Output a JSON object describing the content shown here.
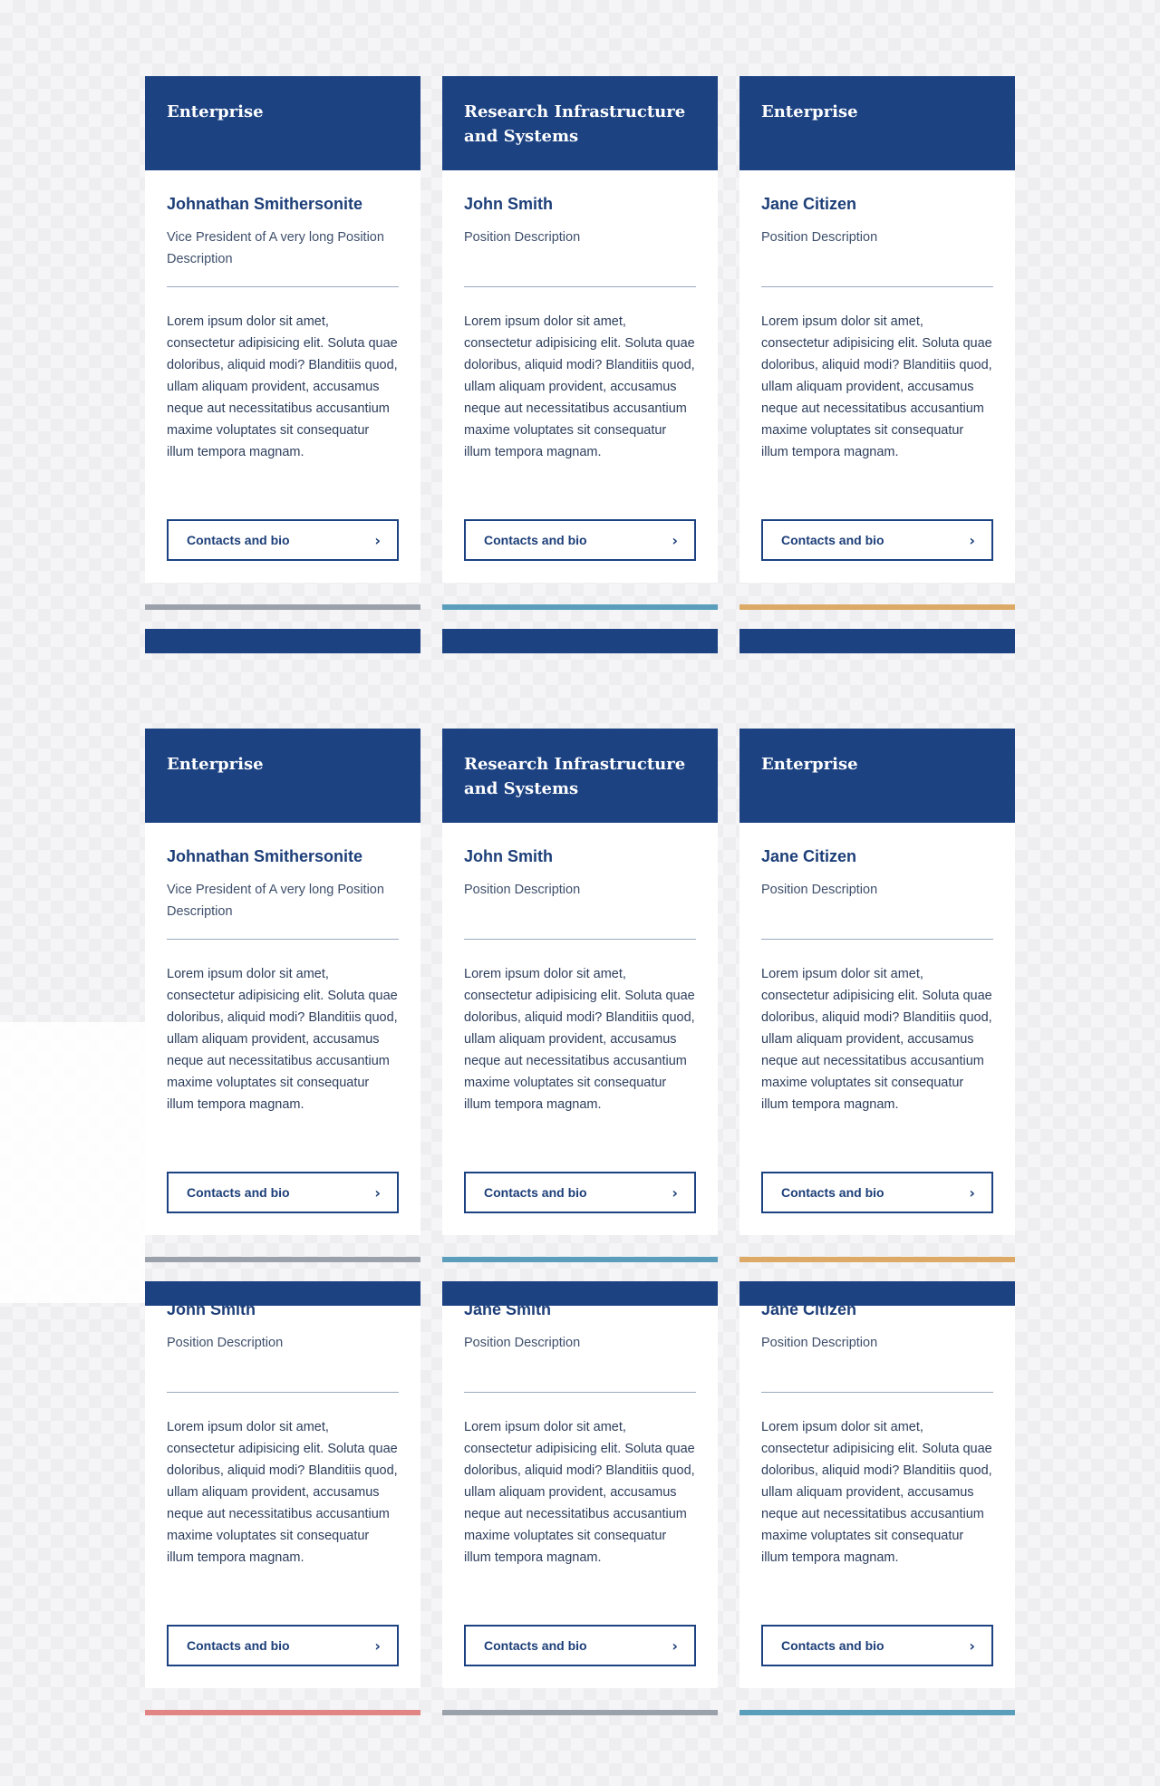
{
  "cards": [
    {
      "org": "Enterprise",
      "name": "Johnathan Smithersonite",
      "position": "Vice President of A very long Position Description",
      "description": "Lorem ipsum dolor sit amet, consectetur adipisicing elit. Soluta quae doloribus, aliquid modi? Blanditiis quod, ullam aliquam provident, accusamus neque aut necessitatibus accusantium maxime voluptates sit consequatur illum tempora magnam.",
      "button": "Contacts and bio",
      "accent": "#9ba1aa"
    },
    {
      "org": "Research Infrastructure and Systems",
      "name": "John Smith",
      "position": "Position Description",
      "description": "Lorem ipsum dolor sit amet, consectetur adipisicing elit. Soluta quae doloribus, aliquid modi? Blanditiis quod, ullam aliquam provident, accusamus neque aut necessitatibus accusantium maxime voluptates sit consequatur illum tempora magnam.",
      "button": "Contacts and bio",
      "accent": "#5a9ebb"
    },
    {
      "org": "Enterprise",
      "name": "Jane Citizen",
      "position": "Position Description",
      "description": "Lorem ipsum dolor sit amet, consectetur adipisicing elit. Soluta quae doloribus, aliquid modi? Blanditiis quod, ullam aliquam provident, accusamus neque aut necessitatibus accusantium maxime voluptates sit consequatur illum tempora magnam.",
      "button": "Contacts and bio",
      "accent": "#dcaa66"
    },
    {
      "org": "Enterprise",
      "name": "Johnathan Smithersonite",
      "position": "Vice President of A very long Position Description",
      "description": "Lorem ipsum dolor sit amet, consectetur adipisicing elit. Soluta quae doloribus, aliquid modi? Blanditiis quod, ullam aliquam provident, accusamus neque aut necessitatibus accusantium maxime voluptates sit consequatur illum tempora magnam.",
      "button": "Contacts and bio",
      "accent": "#9ba1aa"
    },
    {
      "org": "Research Infrastructure and Systems",
      "name": "John Smith",
      "position": "Position Description",
      "description": "Lorem ipsum dolor sit amet, consectetur adipisicing elit. Soluta quae doloribus, aliquid modi? Blanditiis quod, ullam aliquam provident, accusamus neque aut necessitatibus accusantium maxime voluptates sit consequatur illum tempora magnam.",
      "button": "Contacts and bio",
      "accent": "#5a9ebb"
    },
    {
      "org": "Enterprise",
      "name": "Jane Citizen",
      "position": "Position Description",
      "description": "Lorem ipsum dolor sit amet, consectetur adipisicing elit. Soluta quae doloribus, aliquid modi? Blanditiis quod, ullam aliquam provident, accusamus neque aut necessitatibus accusantium maxime voluptates sit consequatur illum tempora magnam.",
      "button": "Contacts and bio",
      "accent": "#dcaa66"
    },
    {
      "org": "",
      "name": "John Smith",
      "position": "Position Description",
      "description": "Lorem ipsum dolor sit amet, consectetur adipisicing elit. Soluta quae doloribus, aliquid modi? Blanditiis quod, ullam aliquam provident, accusamus neque aut necessitatibus accusantium maxime voluptates sit consequatur illum tempora magnam.",
      "button": "Contacts and bio",
      "accent": "#e08484"
    },
    {
      "org": "",
      "name": "Jane Smith",
      "position": "Position Description",
      "description": "Lorem ipsum dolor sit amet, consectetur adipisicing elit. Soluta quae doloribus, aliquid modi? Blanditiis quod, ullam aliquam provident, accusamus neque aut necessitatibus accusantium maxime voluptates sit consequatur illum tempora magnam.",
      "button": "Contacts and bio",
      "accent": "#9ba1aa"
    },
    {
      "org": "",
      "name": "Jane Citizen",
      "position": "Position Description",
      "description": "Lorem ipsum dolor sit amet, consectetur adipisicing elit. Soluta quae doloribus, aliquid modi? Blanditiis quod, ullam aliquam provident, accusamus neque aut necessitatibus accusantium maxime voluptates sit consequatur illum tempora magnam.",
      "button": "Contacts and bio",
      "accent": "#5a9ebb"
    }
  ],
  "colors": {
    "header_blue": "#1c4282",
    "name_blue": "#1c3e78",
    "body_text": "#2d3e5c"
  },
  "icons": {
    "button_chevron": "chevron-right-icon"
  }
}
